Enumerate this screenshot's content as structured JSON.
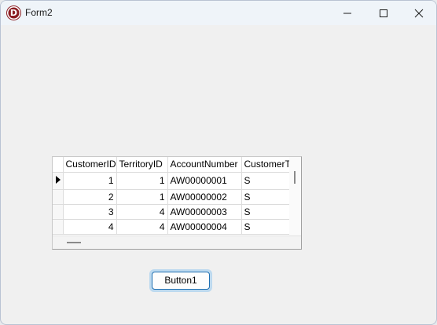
{
  "window": {
    "title": "Form2"
  },
  "grid": {
    "columns": [
      "CustomerID",
      "TerritoryID",
      "AccountNumber",
      "CustomerT"
    ],
    "rows": [
      [
        "1",
        "1",
        "AW00000001",
        "S"
      ],
      [
        "2",
        "1",
        "AW00000002",
        "S"
      ],
      [
        "3",
        "4",
        "AW00000003",
        "S"
      ],
      [
        "4",
        "4",
        "AW00000004",
        "S"
      ]
    ]
  },
  "button1": {
    "label": "Button1"
  },
  "icons": {
    "app": "delphi-app-icon",
    "minimize": "minimize-icon",
    "maximize": "maximize-icon",
    "close": "close-icon",
    "row_pointer": "current-row-pointer-icon"
  },
  "app_icon_letter": "D",
  "colors": {
    "app_icon": "#8b1d22",
    "button_focus": "#1f6fb2"
  }
}
